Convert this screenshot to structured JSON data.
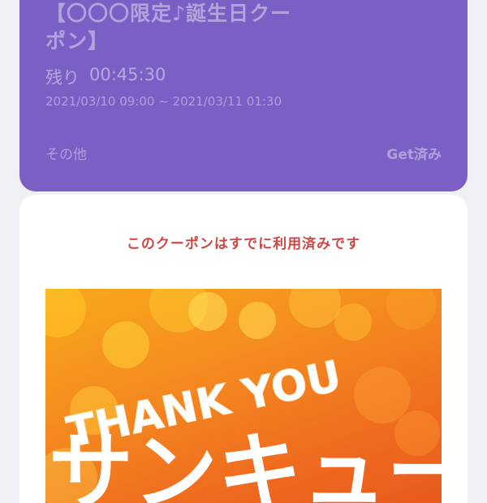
{
  "coupon": {
    "title": "【〇〇〇限定♪誕生日クー\nポン】",
    "remaining_label": "残り",
    "remaining_time": "00:45:30",
    "period": "2021/03/10 09:00 ~ 2021/03/11 01:30",
    "other_label": "その他",
    "status_label": "Get済み",
    "card_color": "#7c5fc4"
  },
  "detail": {
    "used_message": "このクーポンはすでに利用済みです",
    "used_message_color": "#cc4646",
    "banner": {
      "text_en": "THANK YOU",
      "text_jp": "サンキュー"
    }
  }
}
